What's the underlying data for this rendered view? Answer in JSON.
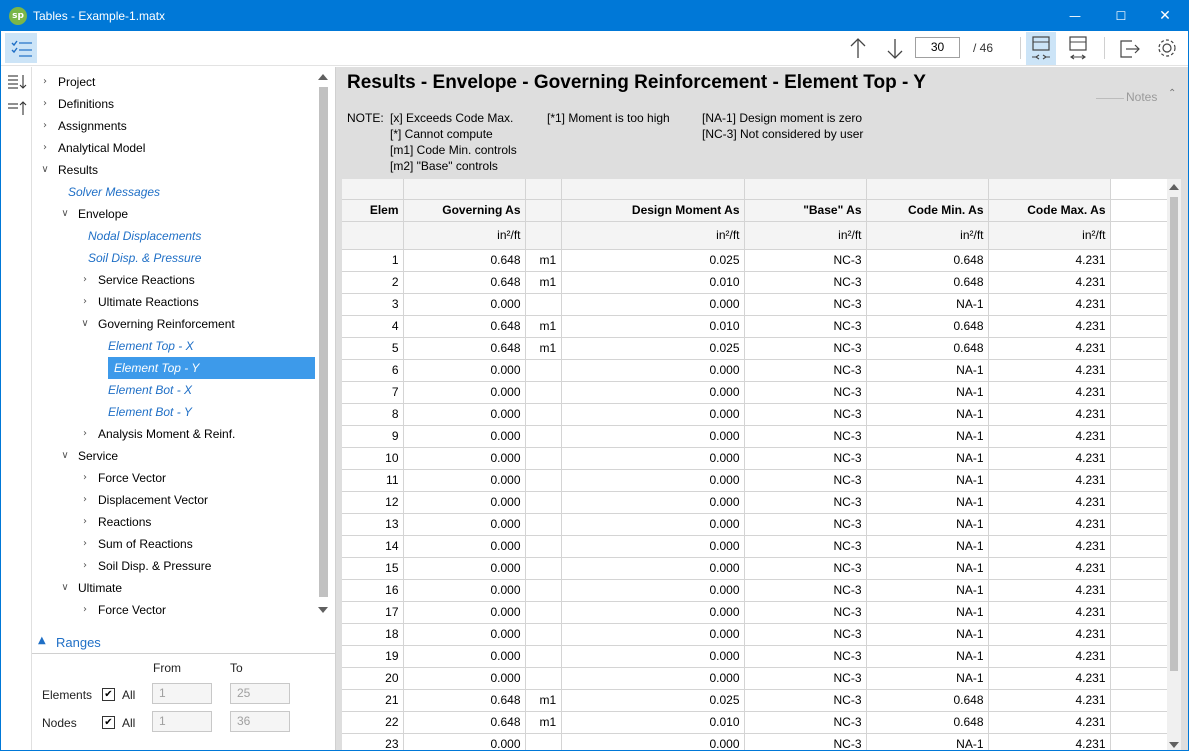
{
  "window": {
    "title": "Tables - Example-1.matx",
    "app_logo": "sp",
    "minimize": "—",
    "maximize": "☐",
    "close": "✕"
  },
  "toolbar": {
    "page_value": "30",
    "page_total": "/ 46"
  },
  "tree": [
    {
      "label": "Project",
      "level": 0,
      "type": "group",
      "expanded": false
    },
    {
      "label": "Definitions",
      "level": 0,
      "type": "group",
      "expanded": false
    },
    {
      "label": "Assignments",
      "level": 0,
      "type": "group",
      "expanded": false
    },
    {
      "label": "Analytical Model",
      "level": 0,
      "type": "group",
      "expanded": false
    },
    {
      "label": "Results",
      "level": 0,
      "type": "group",
      "expanded": true
    },
    {
      "label": "Solver Messages",
      "level": 1,
      "type": "link"
    },
    {
      "label": "Envelope",
      "level": 1,
      "type": "group",
      "expanded": true
    },
    {
      "label": "Nodal Displacements",
      "level": 2,
      "type": "link"
    },
    {
      "label": "Soil Disp. & Pressure",
      "level": 2,
      "type": "link"
    },
    {
      "label": "Service Reactions",
      "level": 2,
      "type": "group",
      "expanded": false
    },
    {
      "label": "Ultimate Reactions",
      "level": 2,
      "type": "group",
      "expanded": false
    },
    {
      "label": "Governing Reinforcement",
      "level": 2,
      "type": "group",
      "expanded": true
    },
    {
      "label": "Element Top - X",
      "level": 3,
      "type": "link"
    },
    {
      "label": "Element Top - Y",
      "level": 3,
      "type": "link",
      "selected": true
    },
    {
      "label": "Element Bot - X",
      "level": 3,
      "type": "link"
    },
    {
      "label": "Element Bot - Y",
      "level": 3,
      "type": "link"
    },
    {
      "label": "Analysis Moment & Reinf.",
      "level": 2,
      "type": "group",
      "expanded": false
    },
    {
      "label": "Service",
      "level": 1,
      "type": "group",
      "expanded": true
    },
    {
      "label": "Force Vector",
      "level": 2,
      "type": "group",
      "expanded": false
    },
    {
      "label": "Displacement Vector",
      "level": 2,
      "type": "group",
      "expanded": false
    },
    {
      "label": "Reactions",
      "level": 2,
      "type": "group",
      "expanded": false
    },
    {
      "label": "Sum of Reactions",
      "level": 2,
      "type": "group",
      "expanded": false
    },
    {
      "label": "Soil Disp. & Pressure",
      "level": 2,
      "type": "group",
      "expanded": false
    },
    {
      "label": "Ultimate",
      "level": 1,
      "type": "group",
      "expanded": true
    },
    {
      "label": "Force Vector",
      "level": 2,
      "type": "group",
      "expanded": false
    }
  ],
  "ranges": {
    "title": "Ranges",
    "from_label": "From",
    "to_label": "To",
    "elements_label": "Elements",
    "nodes_label": "Nodes",
    "all_label": "All",
    "elements_from": "1",
    "elements_to": "25",
    "nodes_from": "1",
    "nodes_to": "36"
  },
  "main": {
    "title": "Results - Envelope - Governing Reinforcement - Element Top - Y",
    "notes_label": "Notes",
    "note_prefix": "NOTE:",
    "notes_col1": [
      "[x] Exceeds Code Max.",
      "[*] Cannot compute",
      "[m1] Code Min. controls",
      "[m2] \"Base\" controls"
    ],
    "notes_col2": [
      "[*1] Moment is too high"
    ],
    "notes_col3": [
      "[NA-1] Design moment is zero",
      "[NC-3] Not considered by user"
    ]
  },
  "table": {
    "headers": [
      "Elem",
      "Governing As",
      "",
      "Design Moment As",
      "\"Base\" As",
      "Code Min. As",
      "Code Max. As"
    ],
    "units": [
      "",
      "in²/ft",
      "",
      "in²/ft",
      "in²/ft",
      "in²/ft",
      "in²/ft"
    ],
    "rows": [
      [
        "1",
        "0.648",
        "m1",
        "0.025",
        "NC-3",
        "0.648",
        "4.231"
      ],
      [
        "2",
        "0.648",
        "m1",
        "0.010",
        "NC-3",
        "0.648",
        "4.231"
      ],
      [
        "3",
        "0.000",
        "",
        "0.000",
        "NC-3",
        "NA-1",
        "4.231"
      ],
      [
        "4",
        "0.648",
        "m1",
        "0.010",
        "NC-3",
        "0.648",
        "4.231"
      ],
      [
        "5",
        "0.648",
        "m1",
        "0.025",
        "NC-3",
        "0.648",
        "4.231"
      ],
      [
        "6",
        "0.000",
        "",
        "0.000",
        "NC-3",
        "NA-1",
        "4.231"
      ],
      [
        "7",
        "0.000",
        "",
        "0.000",
        "NC-3",
        "NA-1",
        "4.231"
      ],
      [
        "8",
        "0.000",
        "",
        "0.000",
        "NC-3",
        "NA-1",
        "4.231"
      ],
      [
        "9",
        "0.000",
        "",
        "0.000",
        "NC-3",
        "NA-1",
        "4.231"
      ],
      [
        "10",
        "0.000",
        "",
        "0.000",
        "NC-3",
        "NA-1",
        "4.231"
      ],
      [
        "11",
        "0.000",
        "",
        "0.000",
        "NC-3",
        "NA-1",
        "4.231"
      ],
      [
        "12",
        "0.000",
        "",
        "0.000",
        "NC-3",
        "NA-1",
        "4.231"
      ],
      [
        "13",
        "0.000",
        "",
        "0.000",
        "NC-3",
        "NA-1",
        "4.231"
      ],
      [
        "14",
        "0.000",
        "",
        "0.000",
        "NC-3",
        "NA-1",
        "4.231"
      ],
      [
        "15",
        "0.000",
        "",
        "0.000",
        "NC-3",
        "NA-1",
        "4.231"
      ],
      [
        "16",
        "0.000",
        "",
        "0.000",
        "NC-3",
        "NA-1",
        "4.231"
      ],
      [
        "17",
        "0.000",
        "",
        "0.000",
        "NC-3",
        "NA-1",
        "4.231"
      ],
      [
        "18",
        "0.000",
        "",
        "0.000",
        "NC-3",
        "NA-1",
        "4.231"
      ],
      [
        "19",
        "0.000",
        "",
        "0.000",
        "NC-3",
        "NA-1",
        "4.231"
      ],
      [
        "20",
        "0.000",
        "",
        "0.000",
        "NC-3",
        "NA-1",
        "4.231"
      ],
      [
        "21",
        "0.648",
        "m1",
        "0.025",
        "NC-3",
        "0.648",
        "4.231"
      ],
      [
        "22",
        "0.648",
        "m1",
        "0.010",
        "NC-3",
        "0.648",
        "4.231"
      ],
      [
        "23",
        "0.000",
        "",
        "0.000",
        "NC-3",
        "NA-1",
        "4.231"
      ]
    ]
  },
  "colors": {
    "accent": "#0078d7",
    "selection": "#3d9aea",
    "link": "#1f6fc6",
    "panel_bg": "#dedede"
  }
}
